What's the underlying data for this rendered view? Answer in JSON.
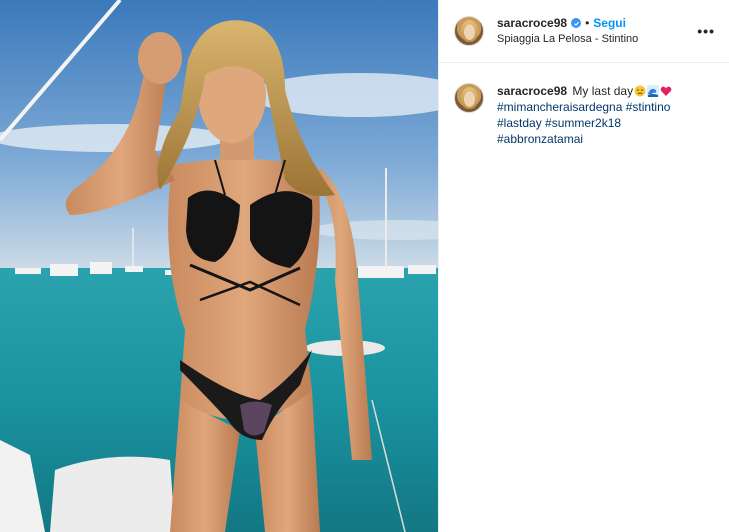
{
  "post": {
    "username": "saracroce98",
    "verified": true,
    "follow_label": "Segui",
    "separator": "•",
    "location": "Spiaggia La Pelosa - Stintino",
    "more_icon": "more-options-icon",
    "caption": {
      "username": "saracroce98",
      "text": "My last day",
      "emojis": [
        "sad-face-emoji",
        "wave-emoji",
        "red-heart-emoji"
      ],
      "hashtags": [
        "#mimancheraisardegna",
        "#stintino",
        "#lastday",
        "#summer2k18",
        "#abbronzatamai"
      ]
    },
    "photo": {
      "description_icon": "beach-boat-photo"
    }
  },
  "colors": {
    "link": "#0095f6",
    "hashtag": "#00376b",
    "verified": "#3897f0",
    "text": "#262626",
    "sea": "#1e9aa6",
    "sky": "#4f8fcc"
  }
}
